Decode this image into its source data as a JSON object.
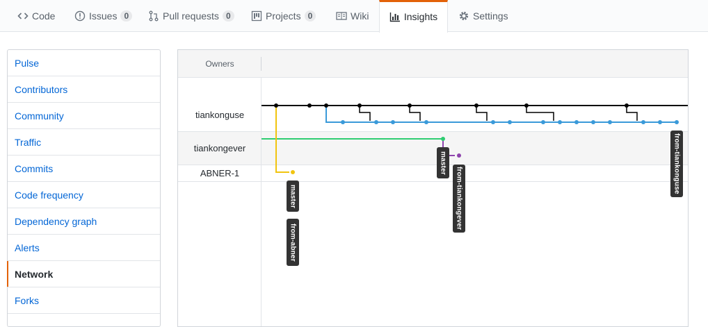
{
  "tabs": [
    {
      "label": "Code",
      "icon": "code-icon",
      "counter": ""
    },
    {
      "label": "Issues",
      "icon": "issue-icon",
      "counter": "0"
    },
    {
      "label": "Pull requests",
      "icon": "pull-request-icon",
      "counter": "0"
    },
    {
      "label": "Projects",
      "icon": "project-icon",
      "counter": "0"
    },
    {
      "label": "Wiki",
      "icon": "book-icon",
      "counter": ""
    },
    {
      "label": "Insights",
      "icon": "graph-icon",
      "counter": ""
    },
    {
      "label": "Settings",
      "icon": "gear-icon",
      "counter": ""
    }
  ],
  "sidebar": {
    "items": [
      {
        "label": "Pulse"
      },
      {
        "label": "Contributors"
      },
      {
        "label": "Community"
      },
      {
        "label": "Traffic"
      },
      {
        "label": "Commits"
      },
      {
        "label": "Code frequency"
      },
      {
        "label": "Dependency graph"
      },
      {
        "label": "Alerts"
      },
      {
        "label": "Network"
      },
      {
        "label": "Forks"
      }
    ]
  },
  "network": {
    "header": "Owners",
    "owners": [
      {
        "name": "tiankonguse"
      },
      {
        "name": "tiankongever"
      },
      {
        "name": "ABNER-1"
      }
    ],
    "branch_labels": [
      {
        "text": "master"
      },
      {
        "text": "from-abner"
      },
      {
        "text": "master"
      },
      {
        "text": "from-tiankongever"
      },
      {
        "text": "from-tiankonguse"
      }
    ],
    "colors": {
      "tiankonguse_master": "#000000",
      "tiankonguse_branch": "#3a9ad9",
      "tiankongever": "#2ecc71",
      "tiankongever_branch": "#8e44ad",
      "abner": "#f1c40f"
    }
  }
}
